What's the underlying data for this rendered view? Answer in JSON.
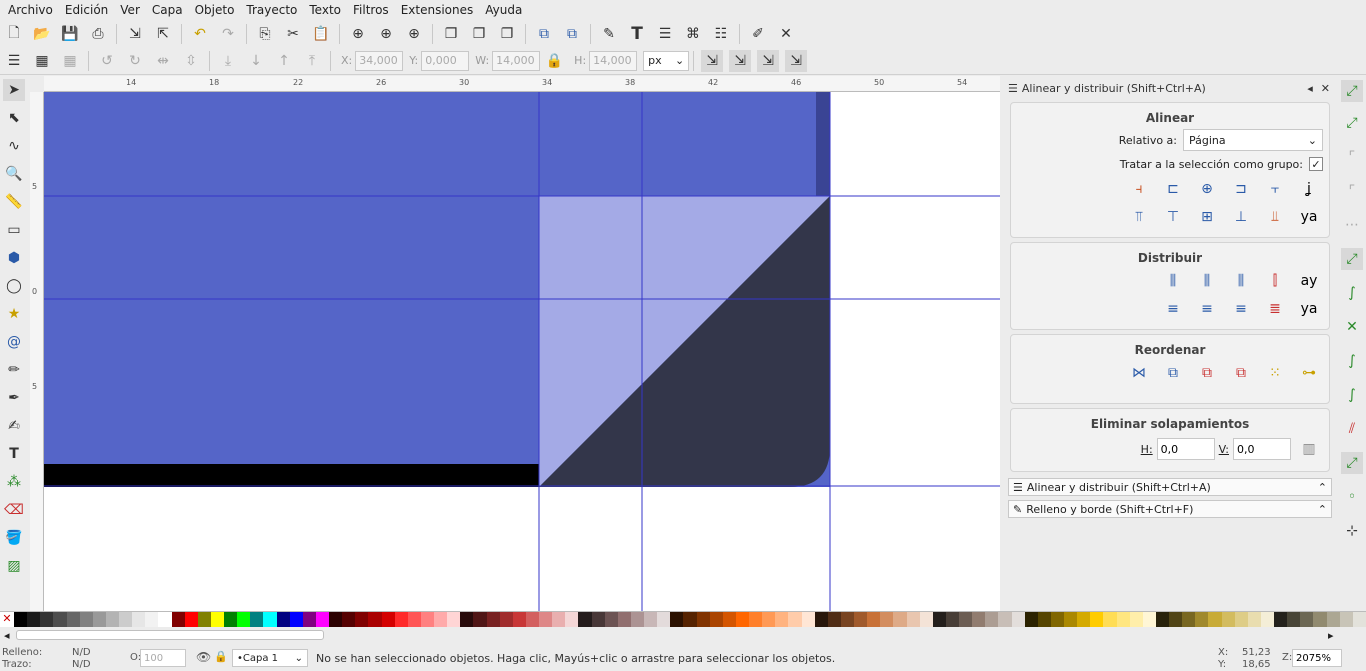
{
  "menu": [
    "Archivo",
    "Edición",
    "Ver",
    "Capa",
    "Objeto",
    "Trayecto",
    "Texto",
    "Filtros",
    "Extensiones",
    "Ayuda"
  ],
  "toolbar2": {
    "x_label": "X:",
    "x_value": "34,000",
    "y_label": "Y:",
    "y_value": "0,000",
    "w_label": "W:",
    "w_value": "14,000",
    "h_label": "H:",
    "h_value": "14,000",
    "unit": "px"
  },
  "ruler": {
    "h_ticks": [
      "14",
      "18",
      "22",
      "26",
      "30",
      "34",
      "38",
      "42",
      "46",
      "50",
      "54"
    ],
    "v_ticks": [
      "5",
      "0",
      "5"
    ]
  },
  "panel": {
    "title": "Alinear y distribuir (Shift+Ctrl+A)",
    "align_title": "Alinear",
    "relative_label": "Relativo a:",
    "relative_value": "Página",
    "group_label": "Tratar a la selección como grupo:",
    "distribute_title": "Distribuir",
    "reorder_title": "Reordenar",
    "overlap_title": "Eliminar solapamientos",
    "h_label": "H:",
    "h_value": "0,0",
    "v_label": "V:",
    "v_value": "0,0",
    "tab1": "Alinear y distribuir (Shift+Ctrl+A)",
    "tab2": "Relleno y borde (Shift+Ctrl+F)"
  },
  "status": {
    "fill_label": "Relleno:",
    "fill_value": "N/D",
    "stroke_label": "Trazo:",
    "stroke_value": "N/D",
    "opacity_label": "O:",
    "opacity_value": "100",
    "layer": "•Capa 1",
    "message": "No se han seleccionado objetos. Haga clic, Mayús+clic o arrastre para seleccionar los objetos.",
    "x_label": "X:",
    "x_value": "51,23",
    "y_label": "Y:",
    "y_value": "18,65",
    "zoom_label": "Z:",
    "zoom_value": "2075%"
  },
  "colors": {
    "canvas_blue": "#5565c8",
    "dark": "#33364a",
    "light_fold": "#a4aae6",
    "guide": "#3535c8"
  }
}
